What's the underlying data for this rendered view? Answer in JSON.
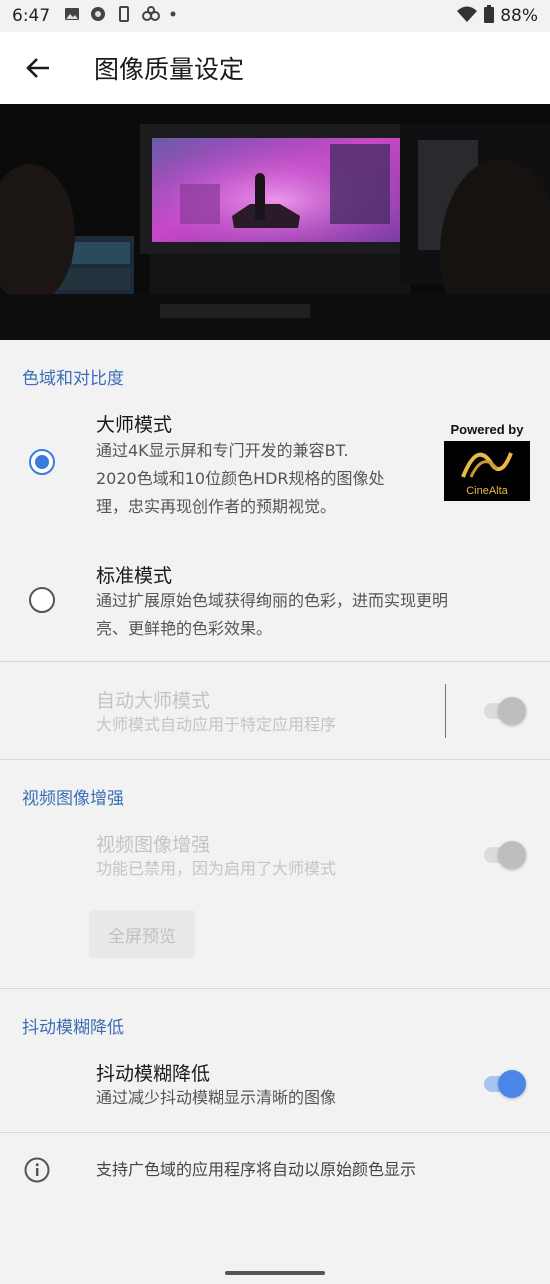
{
  "status": {
    "time": "6:47",
    "battery": "88%"
  },
  "appbar": {
    "title": "图像质量设定"
  },
  "gamut_section": {
    "heading": "色域和对比度",
    "master": {
      "title": "大师模式",
      "desc_lines": [
        "通过4K显示屏和专门开发的兼容BT.",
        "2020色域和10位颜色HDR规格的图像处",
        "理，忠实再现创作者的预期视觉。"
      ],
      "selected": true
    },
    "badge": {
      "powered_by": "Powered by",
      "brand": "CineAlta"
    },
    "standard": {
      "title": "标准模式",
      "desc_lines": [
        "通过扩展原始色域获得绚丽的色彩，进而实现更明",
        "亮、更鲜艳的色彩效果。"
      ],
      "selected": false
    },
    "auto_master": {
      "title": "自动大师模式",
      "desc": "大师模式自动应用于特定应用程序",
      "enabled": false
    }
  },
  "video_section": {
    "heading": "视频图像增强",
    "enhance": {
      "title": "视频图像增强",
      "desc": "功能已禁用，因为启用了大师模式",
      "enabled": false
    },
    "preview_button": "全屏预览"
  },
  "blur_section": {
    "heading": "抖动模糊降低",
    "blur": {
      "title": "抖动模糊降低",
      "desc": "通过减少抖动模糊显示清晰的图像",
      "enabled": true
    }
  },
  "info": {
    "text": "支持广色域的应用程序将自动以原始颜色显示"
  },
  "colors": {
    "accent": "#3b7be0",
    "section_heading": "#3d6fb6",
    "background": "#f2f2f2"
  }
}
